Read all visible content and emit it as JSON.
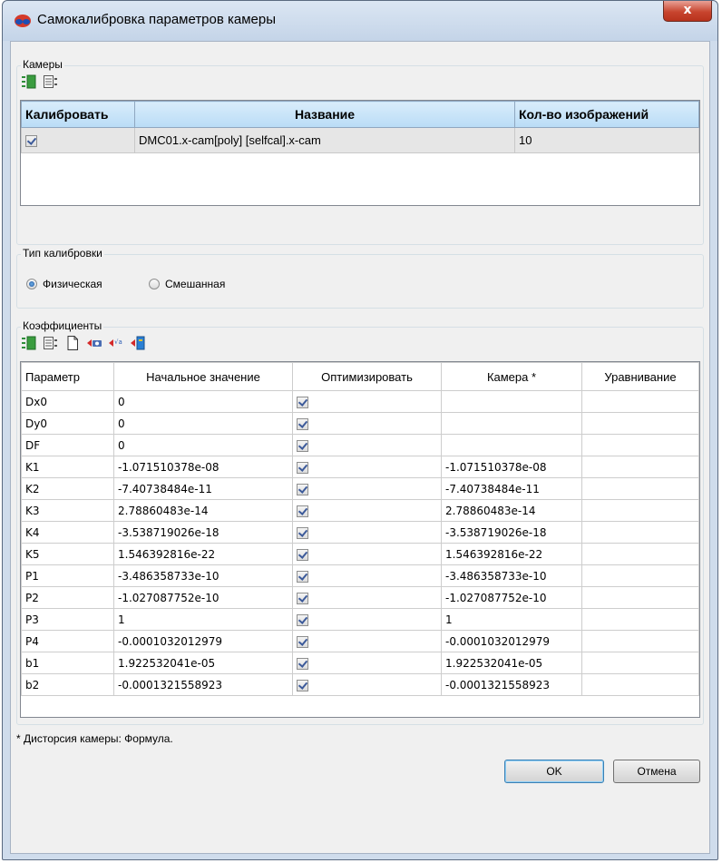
{
  "window": {
    "title": "Самокалибровка параметров камеры",
    "close_label": "x"
  },
  "cameras": {
    "group_title": "Камеры",
    "toolbar": [
      "select-all-icon",
      "deselect-all-icon"
    ],
    "columns": [
      "Калибровать",
      "Название",
      "Кол-во изображений"
    ],
    "rows": [
      {
        "checked": true,
        "name": "DMC01.x-cam[poly] [selfcal].x-cam",
        "images": "10"
      }
    ]
  },
  "calibration_type": {
    "group_title": "Тип калибровки",
    "options": [
      "Физическая",
      "Смешанная"
    ],
    "selected": "Физическая"
  },
  "coefficients": {
    "group_title": "Коэффициенты",
    "toolbar": [
      "select-all-icon",
      "deselect-all-icon",
      "new-page-icon",
      "import-camera-icon",
      "import-values-icon",
      "import-file-icon"
    ],
    "columns": [
      "Параметр",
      "Начальное значение",
      "Оптимизировать",
      "Камера *",
      "Уравнивание"
    ],
    "rows": [
      {
        "param": "Dx0",
        "initial": "0",
        "optimize": true,
        "camera": "",
        "adjust": ""
      },
      {
        "param": "Dy0",
        "initial": "0",
        "optimize": true,
        "camera": "",
        "adjust": ""
      },
      {
        "param": "DF",
        "initial": "0",
        "optimize": true,
        "camera": "",
        "adjust": ""
      },
      {
        "param": "K1",
        "initial": "-1.071510378e-08",
        "optimize": true,
        "camera": "-1.071510378e-08",
        "adjust": ""
      },
      {
        "param": "K2",
        "initial": "-7.40738484e-11",
        "optimize": true,
        "camera": "-7.40738484e-11",
        "adjust": ""
      },
      {
        "param": "K3",
        "initial": "2.78860483e-14",
        "optimize": true,
        "camera": "2.78860483e-14",
        "adjust": ""
      },
      {
        "param": "K4",
        "initial": "-3.538719026e-18",
        "optimize": true,
        "camera": "-3.538719026e-18",
        "adjust": ""
      },
      {
        "param": "K5",
        "initial": "1.546392816e-22",
        "optimize": true,
        "camera": "1.546392816e-22",
        "adjust": ""
      },
      {
        "param": "P1",
        "initial": "-3.486358733e-10",
        "optimize": true,
        "camera": "-3.486358733e-10",
        "adjust": ""
      },
      {
        "param": "P2",
        "initial": "-1.027087752e-10",
        "optimize": true,
        "camera": "-1.027087752e-10",
        "adjust": ""
      },
      {
        "param": "P3",
        "initial": "1",
        "optimize": true,
        "camera": "1",
        "adjust": ""
      },
      {
        "param": "P4",
        "initial": "-0.0001032012979",
        "optimize": true,
        "camera": "-0.0001032012979",
        "adjust": ""
      },
      {
        "param": "b1",
        "initial": "1.922532041e-05",
        "optimize": true,
        "camera": "1.922532041e-05",
        "adjust": ""
      },
      {
        "param": "b2",
        "initial": "-0.0001321558923",
        "optimize": true,
        "camera": "-0.0001321558923",
        "adjust": ""
      }
    ]
  },
  "footnote": "* Дисторсия камеры: Формула.",
  "buttons": {
    "ok": "OK",
    "cancel": "Отмена"
  }
}
